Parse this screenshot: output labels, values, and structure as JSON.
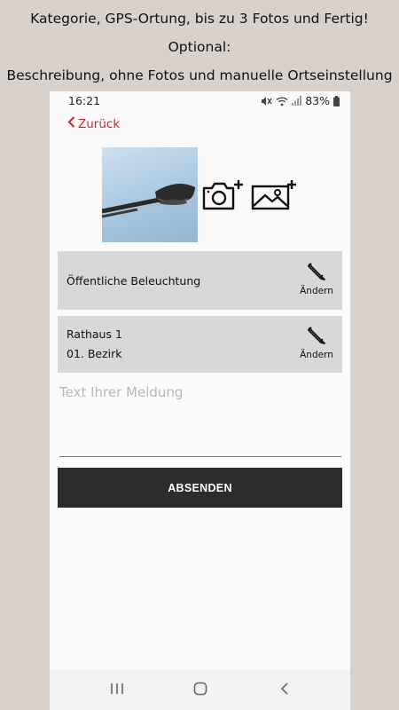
{
  "captions": {
    "line1": "Kategorie, GPS-Ortung, bis zu 3 Fotos und Fertig!",
    "line2": "Optional:",
    "line3": "Beschreibung, ohne Fotos und manuelle Ortseinstellung"
  },
  "status_bar": {
    "time": "16:21",
    "battery": "83%",
    "icons": [
      "mute-icon",
      "wifi-icon",
      "signal-icon",
      "battery-icon"
    ]
  },
  "header": {
    "back_label": "Zurück",
    "accent_color": "#d2232a"
  },
  "photos": {
    "icons": [
      "photo-thumbnail",
      "add-camera-photo-icon",
      "add-gallery-image-icon"
    ]
  },
  "category_card": {
    "label": "Öffentliche Beleuchtung",
    "edit_label": "Ändern"
  },
  "location_card": {
    "line1": "Rathaus 1",
    "line2": "01. Bezirk",
    "edit_label": "Ändern"
  },
  "message": {
    "placeholder": "Text Ihrer Meldung",
    "value": ""
  },
  "submit": {
    "label": "ABSENDEN"
  },
  "nav_bar": {
    "icons": [
      "recent-apps-icon",
      "home-icon",
      "back-icon"
    ]
  }
}
